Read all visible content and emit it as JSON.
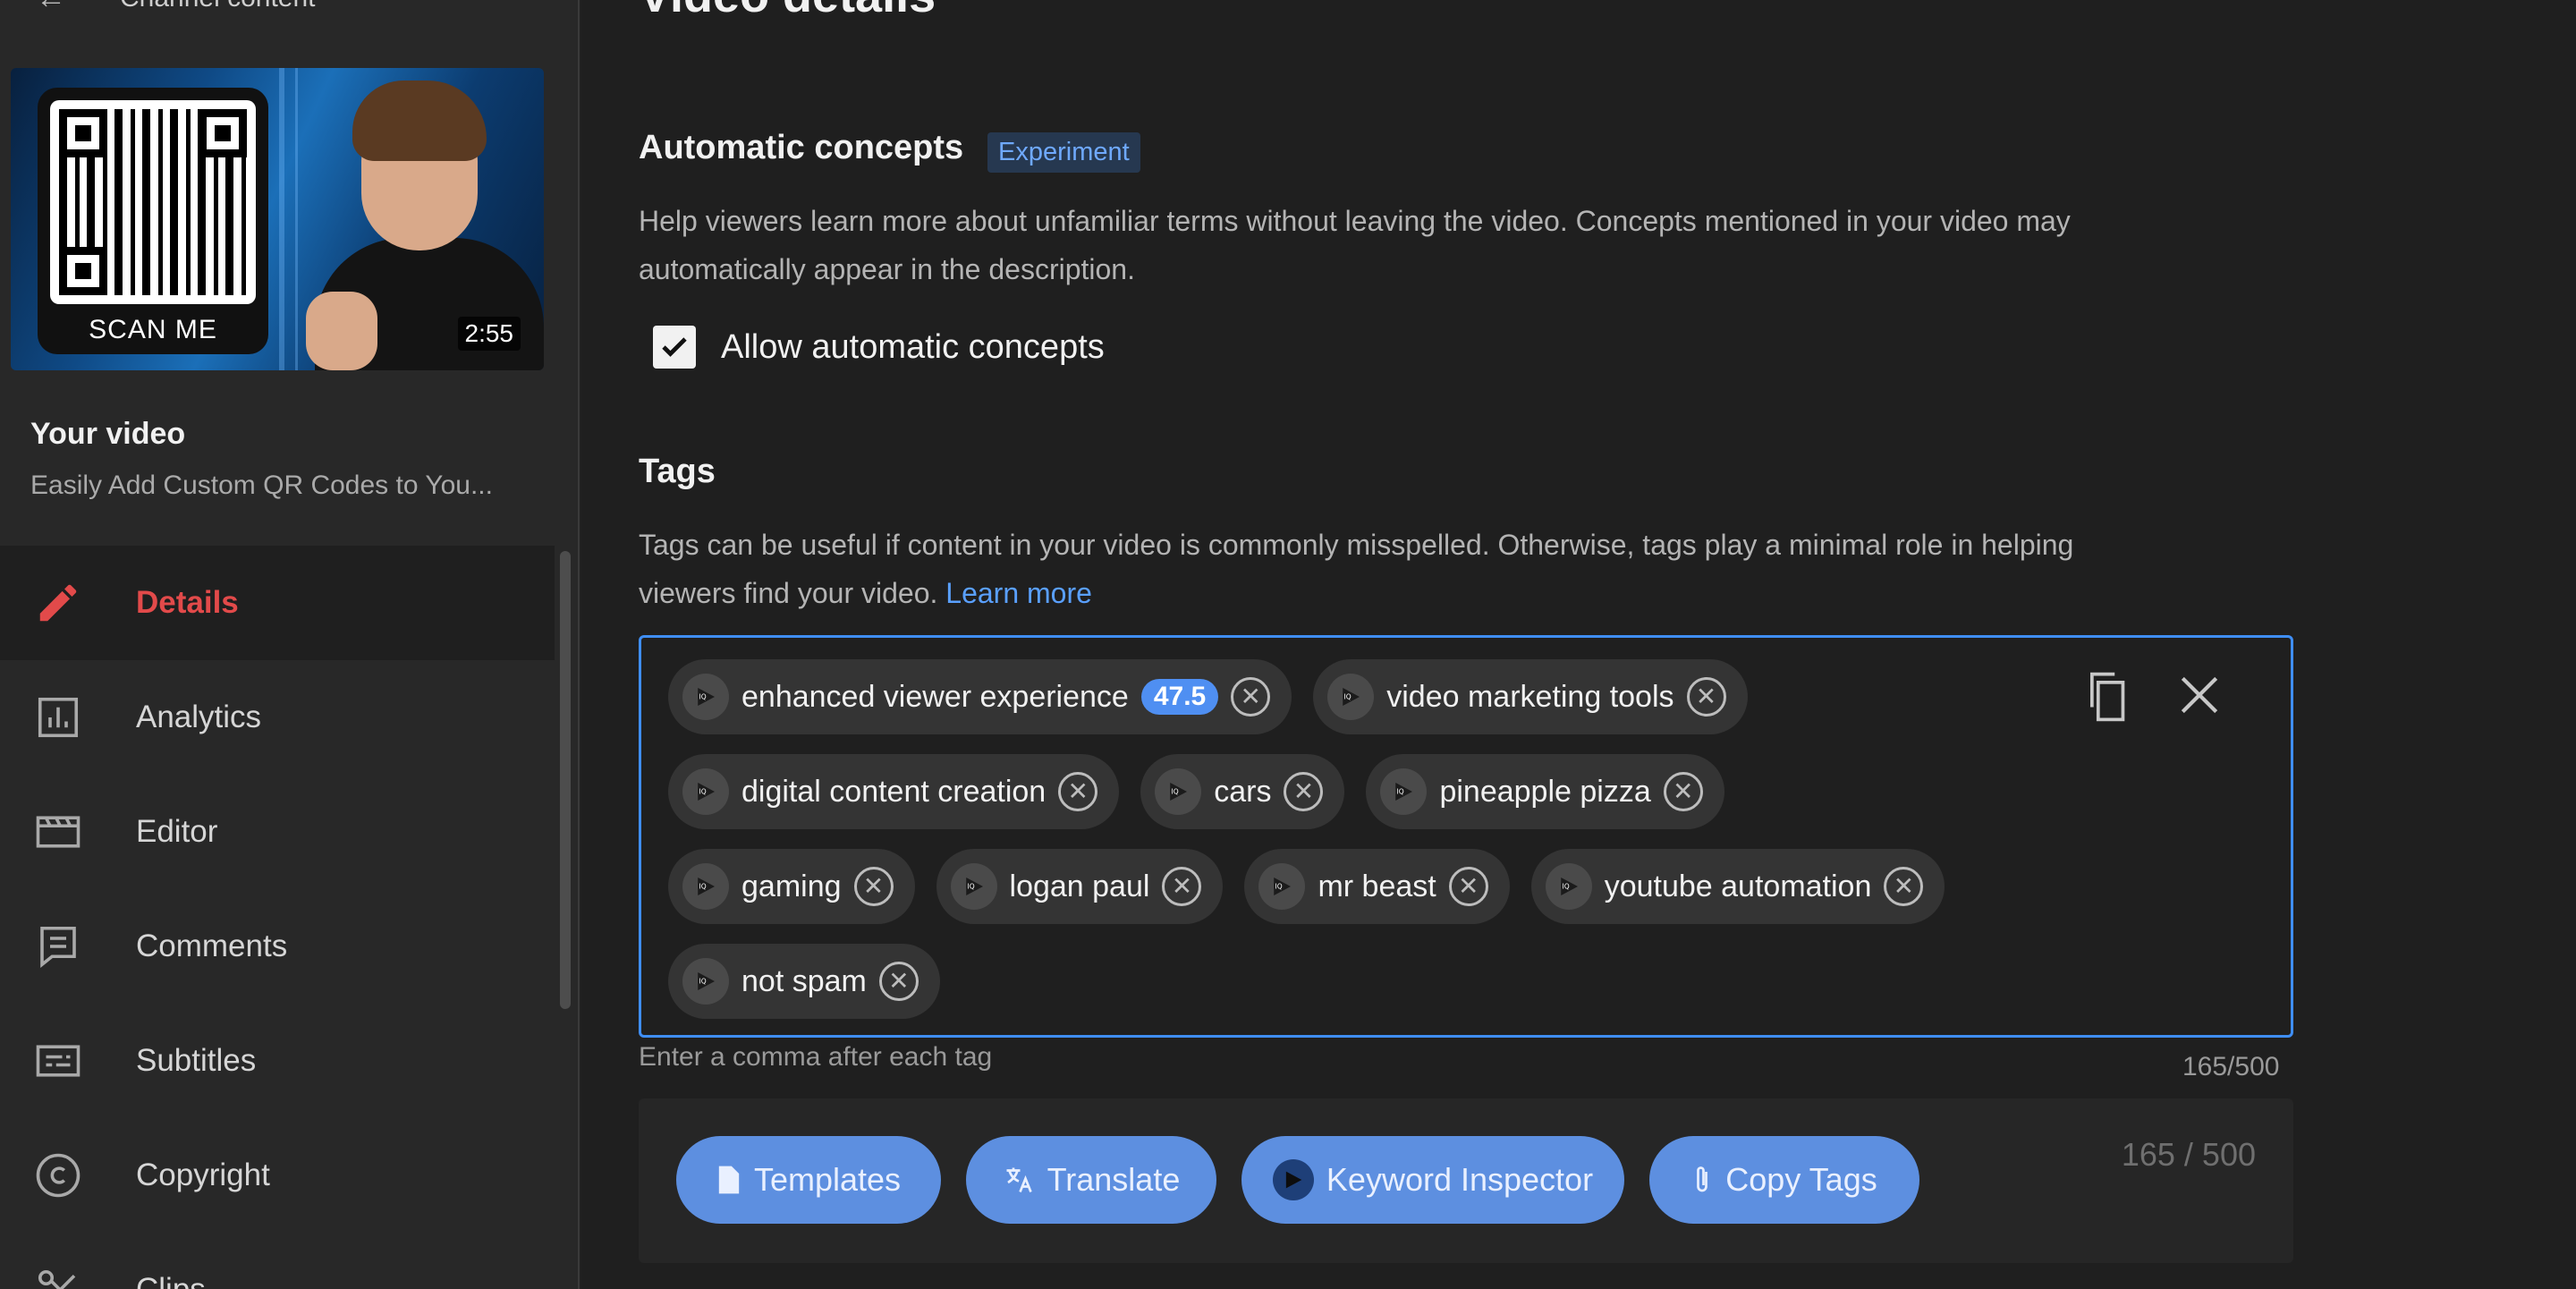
{
  "sidebar": {
    "header_label": "Channel content",
    "thumbnail": {
      "qr_label": "SCAN ME",
      "duration": "2:55"
    },
    "your_video_label": "Your video",
    "video_title": "Easily Add Custom QR Codes to You...",
    "nav_items": [
      {
        "label": "Details",
        "icon": "pencil-icon",
        "active": true
      },
      {
        "label": "Analytics",
        "icon": "analytics-icon"
      },
      {
        "label": "Editor",
        "icon": "clapperboard-icon"
      },
      {
        "label": "Comments",
        "icon": "comment-icon"
      },
      {
        "label": "Subtitles",
        "icon": "subtitles-icon"
      },
      {
        "label": "Copyright",
        "icon": "copyright-icon"
      },
      {
        "label": "Clips",
        "icon": "scissors-icon"
      }
    ]
  },
  "main": {
    "page_title": "Video details",
    "concepts": {
      "title": "Automatic concepts",
      "badge": "Experiment",
      "description_line1": "Help viewers learn more about unfamiliar terms without leaving the video. Concepts mentioned in your video may",
      "description_line2": "automatically appear in the description.",
      "checkbox_label": "Allow automatic concepts",
      "checked": true
    },
    "tags": {
      "title": "Tags",
      "description_line1": "Tags can be useful if content in your video is commonly misspelled. Otherwise, tags play a minimal role in helping",
      "description_line2": "viewers find your video.",
      "learn_more": "Learn more",
      "rows": [
        [
          {
            "label": "enhanced viewer experience",
            "score": "47.5"
          },
          {
            "label": "video marketing tools"
          }
        ],
        [
          {
            "label": "digital content creation"
          },
          {
            "label": "cars"
          },
          {
            "label": "pineapple pizza"
          }
        ],
        [
          {
            "label": "gaming"
          },
          {
            "label": "logan paul"
          },
          {
            "label": "mr beast"
          },
          {
            "label": "youtube automation"
          }
        ],
        [
          {
            "label": "not spam"
          }
        ]
      ],
      "hint": "Enter a comma after each tag",
      "counter": "165/500"
    },
    "toolbar": {
      "templates": "Templates",
      "translate": "Translate",
      "keyword_inspector": "Keyword Inspector",
      "copy_tags": "Copy Tags",
      "counter": "165 / 500"
    }
  },
  "colors": {
    "accent_red": "#e24a4a",
    "focus_blue": "#3f8ef5",
    "button_blue": "#5d8fe0",
    "link_blue": "#5aa0ff"
  }
}
